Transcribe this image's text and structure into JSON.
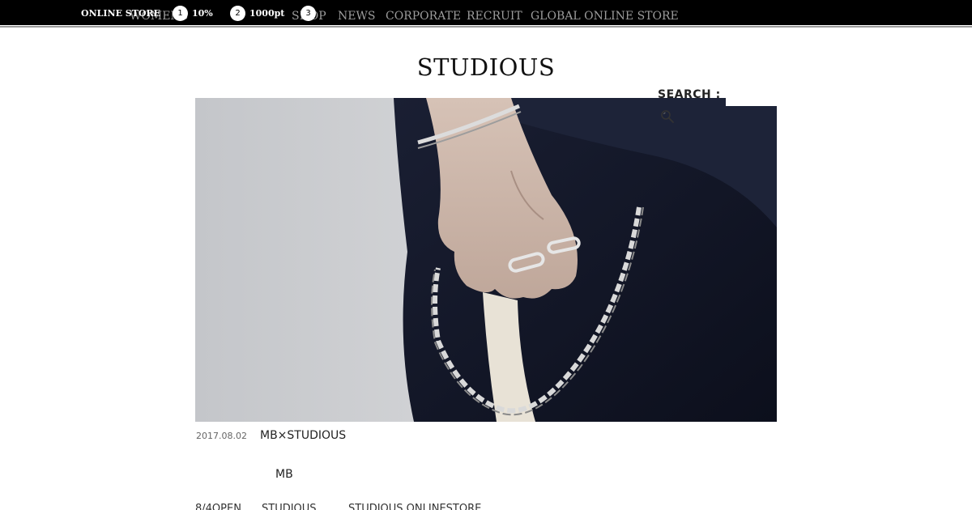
{
  "header": {
    "nav": [
      "WOMENS",
      "SHOP",
      "NEWS",
      "CORPORATE",
      "RECRUIT",
      "GLOBAL ONLINE STORE"
    ],
    "promo": {
      "store_label": "ONLINE STORE",
      "badges": [
        "1",
        "2",
        "3"
      ],
      "values": [
        "10%",
        "1000pt"
      ]
    }
  },
  "logo": "STUDIOUS",
  "search": {
    "label": "SEARCH :",
    "placeholder": "",
    "icon": "search-icon"
  },
  "hero": {
    "icon": "jewelry-photo"
  },
  "article": {
    "date": "2017.08.02",
    "title": "MB×STUDIOUS",
    "subtitle": "MB",
    "body_parts": [
      "8/4OPEN",
      "STUDIOUS",
      "STUDIOUS ONLINESTORE"
    ]
  },
  "colors": {
    "topbar": "#000000",
    "nav_text": "#9c9c9c",
    "promo_text": "#ffffff"
  }
}
